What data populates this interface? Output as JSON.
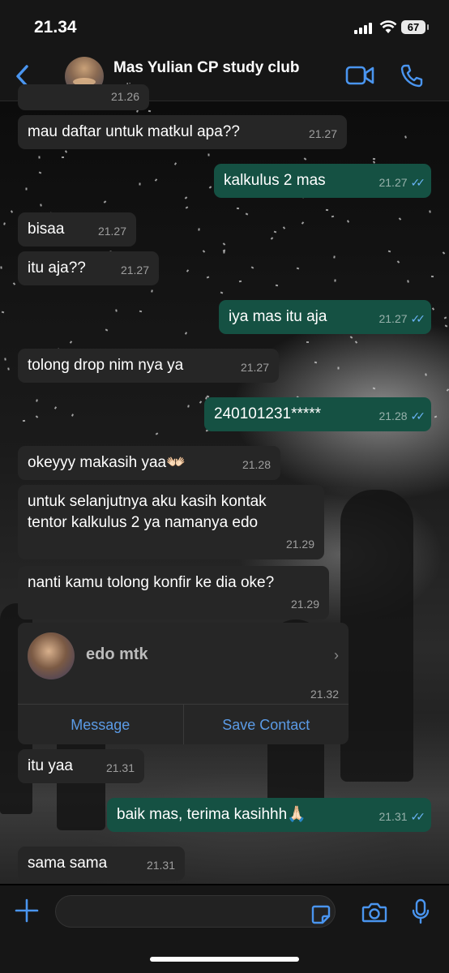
{
  "status": {
    "time": "21.34",
    "battery": "67"
  },
  "header": {
    "title": "Mas Yulian CP study club",
    "subtitle": "online"
  },
  "partial_time": "21.26",
  "messages": [
    {
      "dir": "in",
      "text": "mau daftar untuk matkul apa??",
      "time": "21.27"
    },
    {
      "dir": "out",
      "text": "kalkulus 2 mas",
      "time": "21.27"
    },
    {
      "dir": "in",
      "text": "bisaa",
      "time": "21.27"
    },
    {
      "dir": "in",
      "text": "itu aja??",
      "time": "21.27"
    },
    {
      "dir": "out",
      "text": "iya mas itu aja",
      "time": "21.27"
    },
    {
      "dir": "in",
      "text": "tolong drop nim nya ya",
      "time": "21.27"
    },
    {
      "dir": "out",
      "text": "240101231*****",
      "time": "21.28"
    },
    {
      "dir": "in",
      "text": "okeyyy makasih yaa👐🏻",
      "time": "21.28"
    },
    {
      "dir": "in",
      "text": "untuk selanjutnya aku kasih kontak\ntentor kalkulus 2 ya namanya edo",
      "time": "21.29"
    },
    {
      "dir": "in",
      "text": "nanti kamu tolong konfir ke dia oke?",
      "time": "21.29"
    },
    {
      "dir": "in",
      "text": "itu yaa",
      "time": "21.31"
    },
    {
      "dir": "out",
      "text": "baik mas, terima kasihhh🙏🏻",
      "time": "21.31"
    },
    {
      "dir": "in",
      "text": "sama sama",
      "time": "21.31"
    }
  ],
  "contact_card": {
    "name": "edo mtk",
    "time": "21.32",
    "message_label": "Message",
    "save_label": "Save Contact"
  },
  "input": {
    "placeholder": ""
  },
  "colors": {
    "incoming": "#262626",
    "outgoing": "#155143",
    "accent": "#5b9be6",
    "read_ticks": "#6ab4f7"
  },
  "icons": [
    "back-chevron-icon",
    "video-call-icon",
    "phone-icon",
    "plus-icon",
    "sticker-icon",
    "camera-icon",
    "mic-icon",
    "chevron-right-icon"
  ]
}
